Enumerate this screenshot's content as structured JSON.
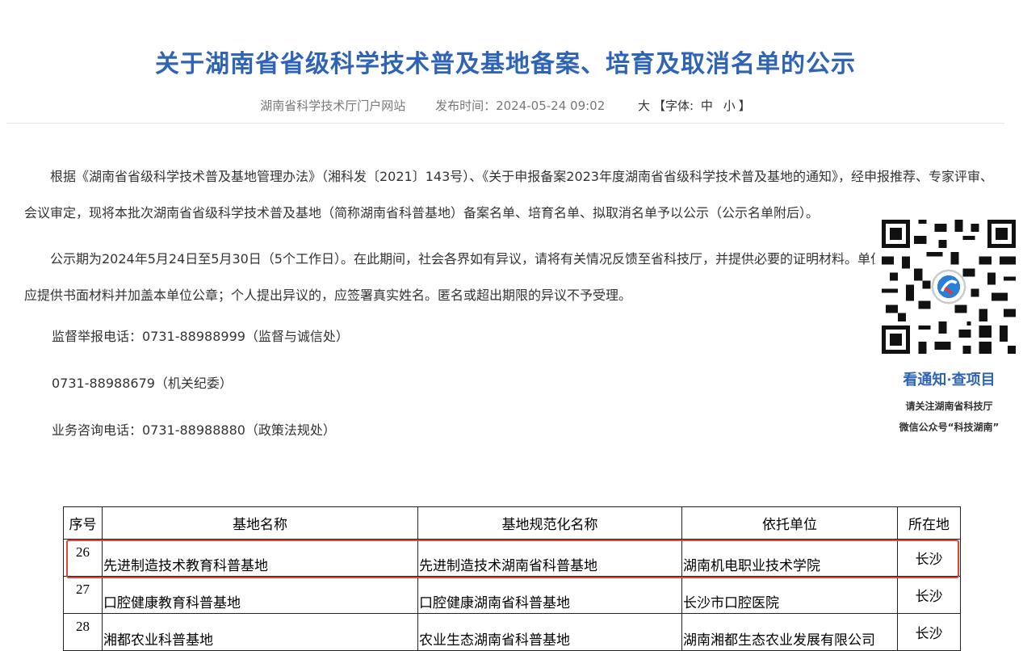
{
  "header": {
    "title": "关于湖南省省级科学技术普及基地备案、培育及取消名单的公示",
    "source": "湖南省科学技术厅门户网站",
    "publish_label": "发布时间：",
    "publish_time": "2024-05-24 09:02",
    "font_big": "大",
    "font_open": "【字体:",
    "font_mid": "中",
    "font_small": "小",
    "font_close": "】"
  },
  "article": {
    "p1": "根据《湖南省省级科学技术普及基地管理办法》（湘科发〔2021〕143号）、《关于申报备案2023年度湖南省省级科学技术普及基地的通知》，经申报推荐、专家评审、会议审定，现将本批次湖南省省级科学技术普及基地（简称湖南省科普基地）备案名单、培育名单、拟取消名单予以公示（公示名单附后）。",
    "p2": "公示期为2024年5月24日至5月30日（5个工作日）。在此期间，社会各界如有异议，请将有关情况反馈至省科技厅，并提供必要的证明材料。单位名义提出异议的，应提供书面材料并加盖本单位公章；个人提出异议的，应签署真实姓名。匿名或超出期限的异议不予受理。",
    "phone1": "监督举报电话：0731-88988999（监督与诚信处）",
    "phone2": "0731-88988679（机关纪委）",
    "phone3": "业务咨询电话：0731-88988880（政策法规处）"
  },
  "qr": {
    "caption1": "看通知·查项目",
    "caption2": "请关注湖南省科技厅",
    "caption3": "微信公众号“科技湖南”"
  },
  "table": {
    "headers": [
      "序号",
      "基地名称",
      "基地规范化名称",
      "依托单位",
      "所在地"
    ],
    "rows": [
      [
        "26",
        "先进制造技术教育科普基地",
        "先进制造技术湖南省科普基地",
        "湖南机电职业技术学院",
        "长沙"
      ],
      [
        "27",
        "口腔健康教育科普基地",
        "口腔健康湖南省科普基地",
        "长沙市口腔医院",
        "长沙"
      ],
      [
        "28",
        "湘都农业科普基地",
        "农业生态湖南省科普基地",
        "湖南湘都生态农业发展有限公司",
        "长沙"
      ]
    ]
  },
  "colors": {
    "title": "#2f63b5",
    "highlight": "#e3443a"
  }
}
